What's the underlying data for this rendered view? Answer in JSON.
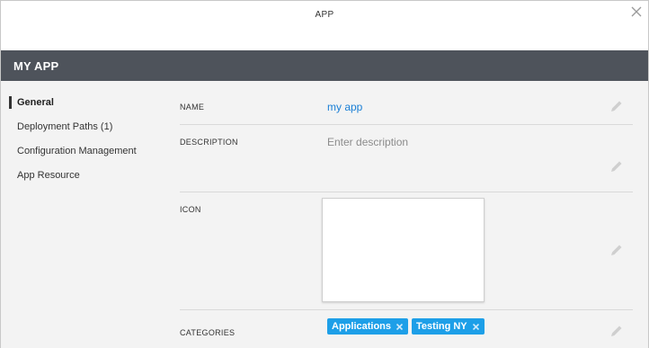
{
  "dialog": {
    "title": "APP"
  },
  "app": {
    "title": "MY APP"
  },
  "sidebar": {
    "items": [
      {
        "label": "General",
        "active": true
      },
      {
        "label": "Deployment Paths (1)",
        "active": false
      },
      {
        "label": "Configuration Management",
        "active": false
      },
      {
        "label": "App Resource",
        "active": false
      }
    ]
  },
  "form": {
    "name": {
      "label": "NAME",
      "value": "my app"
    },
    "description": {
      "label": "DESCRIPTION",
      "placeholder": "Enter description"
    },
    "icon": {
      "label": "ICON"
    },
    "categories": {
      "label": "CATEGORIES",
      "tags": [
        {
          "label": "Applications"
        },
        {
          "label": "Testing NY"
        }
      ]
    }
  },
  "colors": {
    "header_bar": "#4e535b",
    "accent_link": "#1a7fd6",
    "tag_bg": "#1d9fe8",
    "content_bg": "#f3f3f3"
  },
  "icons": {
    "close": "close-icon",
    "edit": "pencil-icon",
    "tag_remove": "close-icon"
  }
}
